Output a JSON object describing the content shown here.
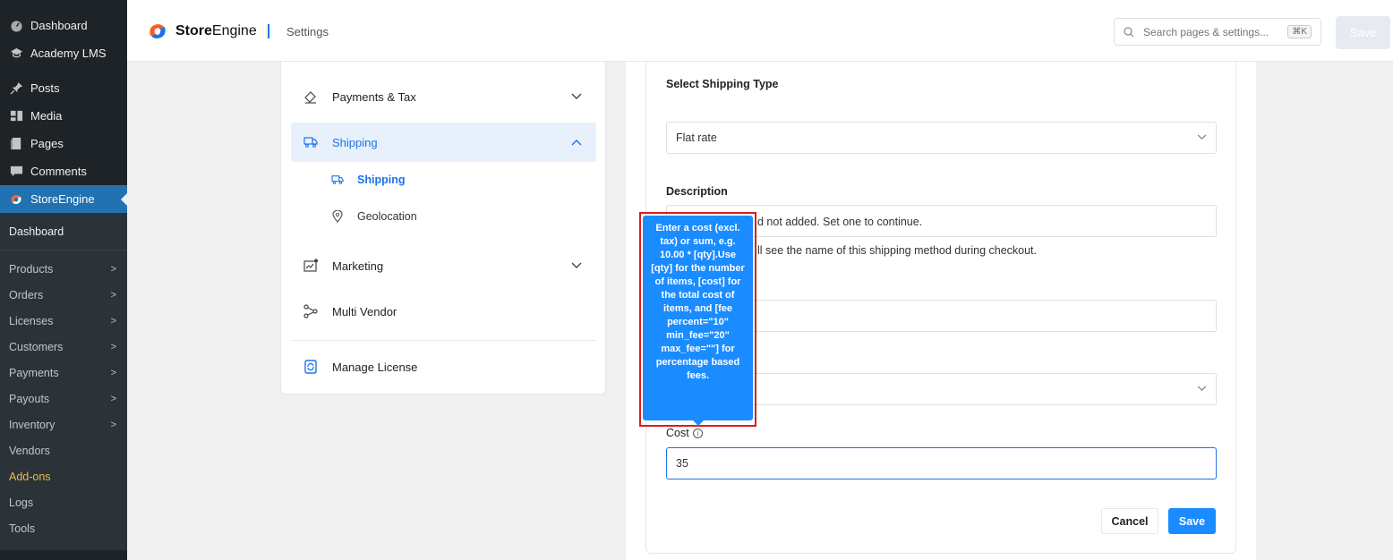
{
  "wp_menu": {
    "top": [
      {
        "label": "Dashboard",
        "icon": "dashboard-icon"
      },
      {
        "label": "Academy LMS",
        "icon": "academy-icon"
      }
    ],
    "main": [
      {
        "label": "Posts",
        "icon": "pin-icon"
      },
      {
        "label": "Media",
        "icon": "media-icon"
      },
      {
        "label": "Pages",
        "icon": "pages-icon"
      },
      {
        "label": "Comments",
        "icon": "comments-icon"
      },
      {
        "label": "StoreEngine",
        "icon": "storeengine-icon"
      }
    ],
    "sub": [
      {
        "label": "Dashboard",
        "chevron": false
      },
      {
        "label": "Products",
        "chevron": true
      },
      {
        "label": "Orders",
        "chevron": true
      },
      {
        "label": "Licenses",
        "chevron": true
      },
      {
        "label": "Customers",
        "chevron": true
      },
      {
        "label": "Payments",
        "chevron": true
      },
      {
        "label": "Payouts",
        "chevron": true
      },
      {
        "label": "Inventory",
        "chevron": true
      },
      {
        "label": "Vendors",
        "chevron": false
      },
      {
        "label": "Add-ons",
        "chevron": false
      },
      {
        "label": "Logs",
        "chevron": false
      },
      {
        "label": "Tools",
        "chevron": false
      }
    ],
    "chevron_glyph": ">"
  },
  "header": {
    "brand_bold": "Store",
    "brand_light": "Engine",
    "crumb": "Settings",
    "search_placeholder": "Search pages & settings...",
    "search_kbd": "⌘K",
    "save_label": "Save",
    "brand_color": "#1a73e8"
  },
  "settings_nav": {
    "items": [
      {
        "label": "Payments & Tax",
        "icon": "payment-tag-icon",
        "chevron": "⌄"
      },
      {
        "label": "Shipping",
        "icon": "truck-icon",
        "chevron": "⌃"
      },
      {
        "label": "Marketing",
        "icon": "marketing-icon",
        "chevron": "⌄"
      },
      {
        "label": "Multi Vendor",
        "icon": "multi-vendor-icon"
      },
      {
        "label": "Manage License",
        "icon": "license-icon"
      }
    ],
    "shipping_sub": [
      {
        "label": "Shipping",
        "icon": "truck-icon"
      },
      {
        "label": "Geolocation",
        "icon": "location-pin-icon"
      }
    ]
  },
  "form": {
    "shipping_type_label": "Select Shipping Type",
    "shipping_type_value": "Flat rate",
    "description_label": "Description",
    "description_partial_value": "d not added. Set one to continue.",
    "description_partial_help": "ll see the name of this shipping method during checkout.",
    "cost_label": "Cost",
    "cost_value": "35",
    "cancel_label": "Cancel",
    "save_label": "Save"
  },
  "tooltip": {
    "text": "Enter a cost (excl. tax) or sum, e.g. 10.00 * [qty].Use [qty] for the number of items, [cost] for the total cost of items, and [fee percent=\"10\" min_fee=\"20\" max_fee=\"\"] for percentage based fees."
  },
  "colors": {
    "wp_sidebar": "#1d2327",
    "wp_active": "#2271b1",
    "primary": "#1a8cff",
    "highlight_frame": "#e01b1b",
    "addon": "#f0b849"
  }
}
